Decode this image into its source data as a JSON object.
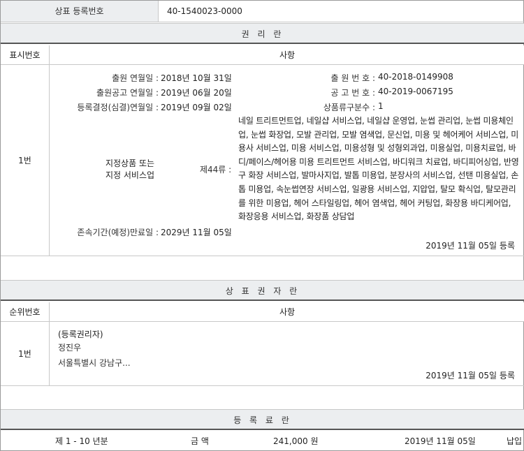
{
  "registration": {
    "label": "상표 등록번호",
    "value": "40-1540023-0000"
  },
  "rights_section": {
    "title": "권 리 란",
    "col_left": "표시번호",
    "col_right": "사항",
    "row_no": "1번",
    "application_date_label": "출원 연월일 :",
    "application_date": "2018년 10월 31일",
    "application_no_label": "출 원 번 호 :",
    "application_no": "40-2018-0149908",
    "publication_date_label": "출원공고 연월일 :",
    "publication_date": "2019년 06월 20일",
    "publication_no_label": "공 고 번 호 :",
    "publication_no": "40-2019-0067195",
    "decision_date_label": "등록결정(심결)연월일 :",
    "decision_date": "2019년 09월 02일",
    "class_count_label": "상품류구분수 :",
    "class_count": "1",
    "goods_title_line1": "지정상품 또는",
    "goods_title_line2": "지정 서비스업",
    "class_label": "제44류 :",
    "goods_text": "네일 트리트먼트업, 네일샵 서비스업, 네일샵 운영업, 눈썹 관리업, 눈썹 미용체인업, 눈썹 화장업, 모발 관리업, 모발 염색업, 문신업, 미용 및 헤어케어 서비스업, 미용사 서비스업, 미용 서비스업, 미용성형 및 성형외과업, 미용실업, 미용치료업, 바디/페이스/헤어용 미용 트리트먼트 서비스업, 바디워크 치료업, 바디피어싱업, 반영구 화장 서비스업, 발마사지업, 발톱 미용업, 분장사의 서비스업, 선탠 미용실업, 손톱 미용업, 속눈썹연장 서비스업, 일광용 서비스업, 지압업, 탈모 확식업, 탈모관리를 위한 미용업, 헤어 스타일링업, 헤어 염색업, 헤어 커팅업, 화장용 바디케어업, 화장응용 서비스업, 화장품 상담업",
    "expiry_label": "존속기간(예정)만료일 :",
    "expiry_date": "2029년 11월 05일",
    "registered_stamp": "2019년 11월 05일 등록"
  },
  "owner_section": {
    "title": "상 표 권 자 란",
    "col_left": "순위번호",
    "col_right": "사항",
    "row_no": "1번",
    "tag": "(등록권리자)",
    "name": "정진우",
    "address": "서울특별시 강남구...",
    "registered_stamp": "2019년 11월 05일 등록"
  },
  "fee_section": {
    "title": "등 록 료 란",
    "period": "제 1 - 10 년분",
    "amount_label": "금 액",
    "amount": "241,000 원",
    "date": "2019년 11월 05일",
    "status": "납입"
  }
}
